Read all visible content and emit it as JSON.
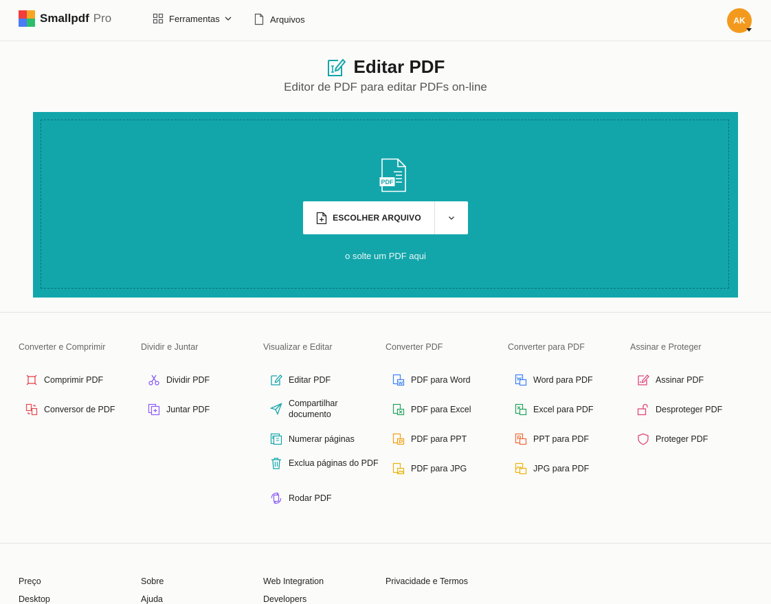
{
  "header": {
    "logo_text": "Smallpdf",
    "logo_pro": "Pro",
    "tools_label": "Ferramentas",
    "files_label": "Arquivos",
    "avatar_initials": "AK",
    "logo_colors": [
      "#f23d3d",
      "#f5a623",
      "#4a7cf5",
      "#2ebd6b"
    ]
  },
  "hero": {
    "title": "Editar PDF",
    "subtitle": "Editor de PDF para editar PDFs on-line",
    "choose_file_label": "ESCOLHER ARQUIVO",
    "drop_hint": "o solte um PDF aqui",
    "pdf_badge": "PDF",
    "accent_color": "#12a6ab"
  },
  "tools": {
    "columns": [
      {
        "heading": "Converter e Comprimir",
        "items": [
          {
            "label": "Comprimir PDF",
            "icon": "compress-icon"
          },
          {
            "label": "Conversor de PDF",
            "icon": "converter-icon"
          }
        ]
      },
      {
        "heading": "Dividir e Juntar",
        "items": [
          {
            "label": "Dividir PDF",
            "icon": "scissors-icon"
          },
          {
            "label": "Juntar PDF",
            "icon": "merge-icon"
          }
        ]
      },
      {
        "heading": "Visualizar e Editar",
        "items": [
          {
            "label": "Editar PDF",
            "icon": "edit-icon"
          },
          {
            "label": "Compartilhar documento",
            "icon": "share-icon"
          },
          {
            "label": "Numerar páginas",
            "icon": "number-pages-icon"
          },
          {
            "label": "Exclua páginas do PDF",
            "icon": "trash-icon"
          },
          {
            "label": "Rodar PDF",
            "icon": "rotate-icon"
          }
        ]
      },
      {
        "heading": "Converter PDF",
        "items": [
          {
            "label": "PDF para Word",
            "icon": "pdf-to-word-icon"
          },
          {
            "label": "PDF para Excel",
            "icon": "pdf-to-excel-icon"
          },
          {
            "label": "PDF para PPT",
            "icon": "pdf-to-ppt-icon"
          },
          {
            "label": "PDF para JPG",
            "icon": "pdf-to-jpg-icon"
          }
        ]
      },
      {
        "heading": "Converter para PDF",
        "items": [
          {
            "label": "Word para PDF",
            "icon": "word-to-pdf-icon"
          },
          {
            "label": "Excel para PDF",
            "icon": "excel-to-pdf-icon"
          },
          {
            "label": "PPT para PDF",
            "icon": "ppt-to-pdf-icon"
          },
          {
            "label": "JPG para PDF",
            "icon": "jpg-to-pdf-icon"
          }
        ]
      },
      {
        "heading": "Assinar e Proteger",
        "items": [
          {
            "label": "Assinar PDF",
            "icon": "sign-icon"
          },
          {
            "label": "Desproteger PDF",
            "icon": "unlock-icon"
          },
          {
            "label": "Proteger PDF",
            "icon": "shield-icon"
          }
        ]
      }
    ]
  },
  "footer": {
    "links": [
      [
        "Preço",
        "Desktop"
      ],
      [
        "Sobre",
        "Ajuda"
      ],
      [
        "Web Integration",
        "Developers"
      ],
      [
        "Privacidade e Termos"
      ]
    ]
  }
}
